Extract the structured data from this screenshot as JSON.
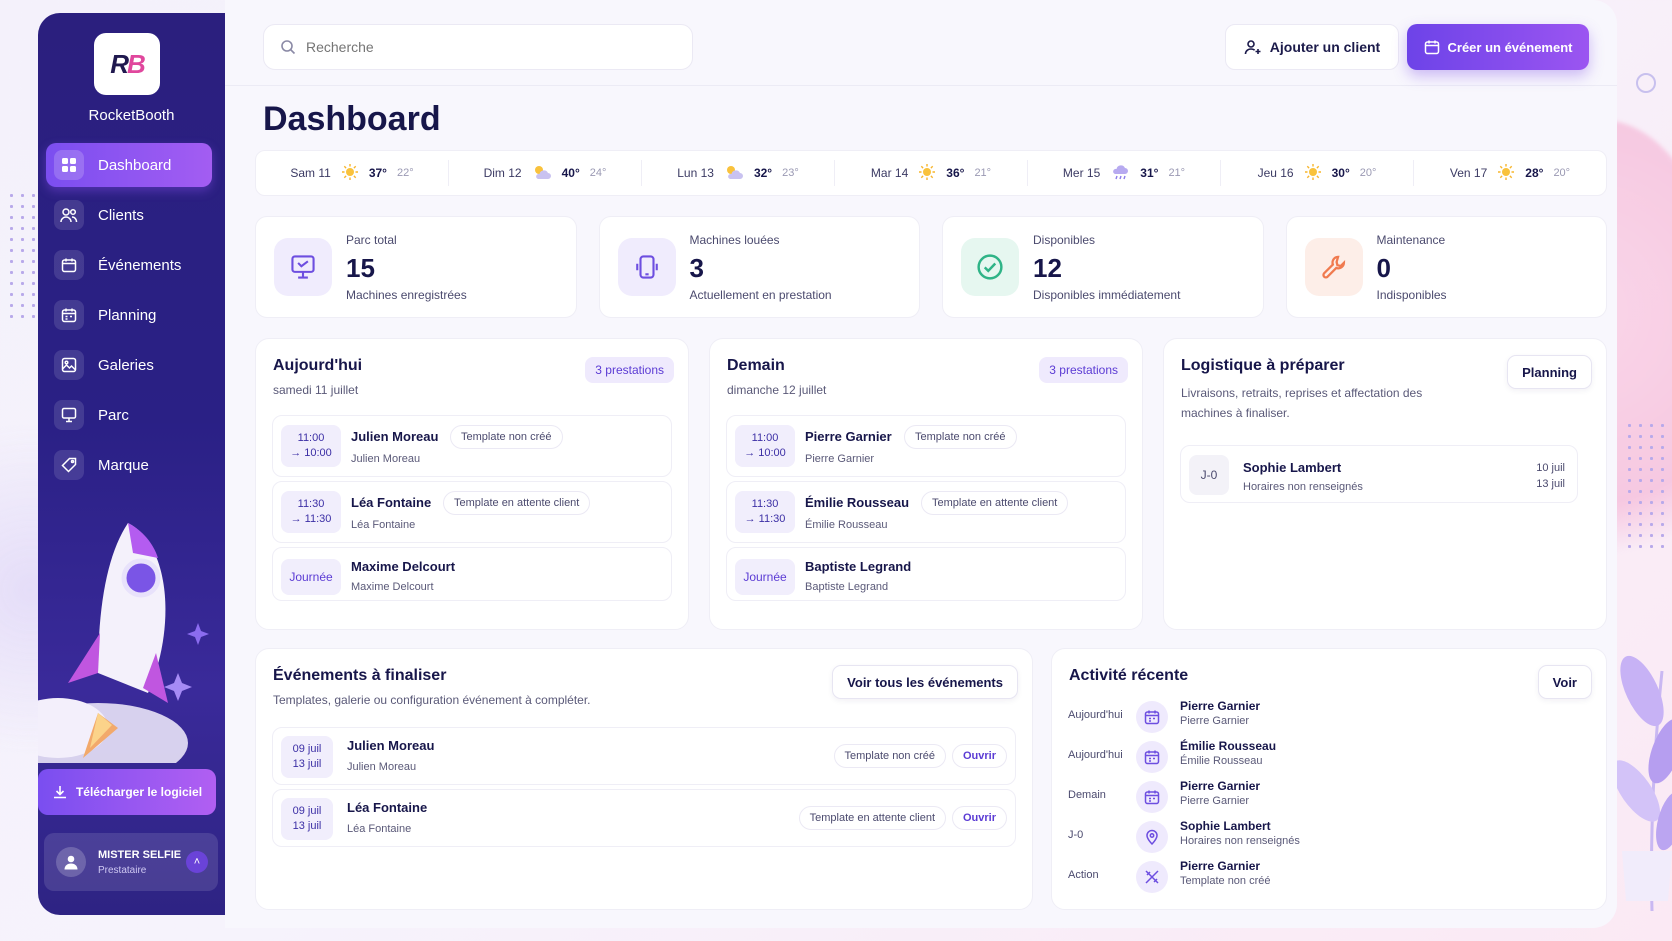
{
  "brand": {
    "name": "RocketBooth",
    "logo_text": "RB"
  },
  "sidebar": {
    "items": [
      {
        "label": "Dashboard",
        "icon": "grid-icon",
        "active": true
      },
      {
        "label": "Clients",
        "icon": "users-icon"
      },
      {
        "label": "Événements",
        "icon": "calendar-icon"
      },
      {
        "label": "Planning",
        "icon": "planning-icon"
      },
      {
        "label": "Galeries",
        "icon": "image-icon"
      },
      {
        "label": "Parc",
        "icon": "monitor-icon"
      },
      {
        "label": "Marque",
        "icon": "tag-icon"
      }
    ],
    "download_label": "Télécharger le logiciel",
    "user": {
      "name": "MISTER SELFIE",
      "role": "Prestataire"
    }
  },
  "header": {
    "search_placeholder": "Recherche",
    "add_client_label": "Ajouter un client",
    "create_event_label": "Créer un événement"
  },
  "page_title": "Dashboard",
  "weather": [
    {
      "day": "Sam 11",
      "icon": "sun",
      "max": "37°",
      "min": "22°"
    },
    {
      "day": "Dim 12",
      "icon": "partly-cloudy",
      "max": "40°",
      "min": "24°"
    },
    {
      "day": "Lun 13",
      "icon": "partly-cloudy",
      "max": "32°",
      "min": "23°"
    },
    {
      "day": "Mar 14",
      "icon": "sun",
      "max": "36°",
      "min": "21°"
    },
    {
      "day": "Mer 15",
      "icon": "rain",
      "max": "31°",
      "min": "21°"
    },
    {
      "day": "Jeu 16",
      "icon": "sun",
      "max": "30°",
      "min": "20°"
    },
    {
      "day": "Ven 17",
      "icon": "sun",
      "max": "28°",
      "min": "20°"
    }
  ],
  "stats": [
    {
      "label": "Parc total",
      "value": "15",
      "sub": "Machines enregistrées",
      "icon": "monitor-icon",
      "color": "#6d4ee0",
      "bg": "#f0ecfd"
    },
    {
      "label": "Machines louées",
      "value": "3",
      "sub": "Actuellement en prestation",
      "icon": "phone-icon",
      "color": "#6d4ee0",
      "bg": "#f0ecfd"
    },
    {
      "label": "Disponibles",
      "value": "12",
      "sub": "Disponibles immédiatement",
      "icon": "check-icon",
      "color": "#2fb487",
      "bg": "#e6f7f0"
    },
    {
      "label": "Maintenance",
      "value": "0",
      "sub": "Indisponibles",
      "icon": "wrench-icon",
      "color": "#f07a4f",
      "bg": "#fdeee8"
    }
  ],
  "today": {
    "title": "Aujourd'hui",
    "date": "samedi 11 juillet",
    "count": "3 prestations",
    "items": [
      {
        "t1": "11:00",
        "t2": "→ 10:00",
        "name": "Julien Moreau",
        "sub": "Julien Moreau",
        "tag": "Template non créé"
      },
      {
        "t1": "11:30",
        "t2": "→ 11:30",
        "name": "Léa Fontaine",
        "sub": "Léa Fontaine",
        "tag": "Template en attente client"
      },
      {
        "t1": "Journée",
        "t2": "",
        "name": "Maxime Delcourt",
        "sub": "Maxime Delcourt",
        "tag": ""
      }
    ]
  },
  "tomorrow": {
    "title": "Demain",
    "date": "dimanche 12 juillet",
    "count": "3 prestations",
    "items": [
      {
        "t1": "11:00",
        "t2": "→ 10:00",
        "name": "Pierre Garnier",
        "sub": "Pierre Garnier",
        "tag": "Template non créé"
      },
      {
        "t1": "11:30",
        "t2": "→ 11:30",
        "name": "Émilie Rousseau",
        "sub": "Émilie Rousseau",
        "tag": "Template en attente client"
      },
      {
        "t1": "Journée",
        "t2": "",
        "name": "Baptiste Legrand",
        "sub": "Baptiste Legrand",
        "tag": ""
      }
    ]
  },
  "logistics": {
    "title": "Logistique à préparer",
    "desc1": "Livraisons, retraits, reprises et affectation des",
    "desc2": "machines à finaliser.",
    "button": "Planning",
    "item": {
      "badge": "J-0",
      "name": "Sophie Lambert",
      "sub": "Horaires non renseignés",
      "d1": "10 juil",
      "d2": "13 juil"
    }
  },
  "finalize": {
    "title": "Événements à finaliser",
    "desc": "Templates, galerie ou configuration événement à compléter.",
    "button": "Voir tous les événements",
    "items": [
      {
        "d1": "09 juil",
        "d2": "13 juil",
        "name": "Julien Moreau",
        "sub": "Julien Moreau",
        "tag": "Template non créé",
        "action": "Ouvrir"
      },
      {
        "d1": "09 juil",
        "d2": "13 juil",
        "name": "Léa Fontaine",
        "sub": "Léa Fontaine",
        "tag": "Template en attente client",
        "action": "Ouvrir"
      }
    ]
  },
  "activity": {
    "title": "Activité récente",
    "button": "Voir",
    "items": [
      {
        "when": "Aujourd'hui",
        "icon": "calendar-icon",
        "name": "Pierre Garnier",
        "sub": "Pierre Garnier"
      },
      {
        "when": "Aujourd'hui",
        "icon": "calendar-icon",
        "name": "Émilie Rousseau",
        "sub": "Émilie Rousseau"
      },
      {
        "when": "Demain",
        "icon": "calendar-icon",
        "name": "Pierre Garnier",
        "sub": "Pierre Garnier"
      },
      {
        "when": "J-0",
        "icon": "pin-icon",
        "name": "Sophie Lambert",
        "sub": "Horaires non renseignés"
      },
      {
        "when": "Action",
        "icon": "tools-icon",
        "name": "Pierre Garnier",
        "sub": "Template non créé"
      }
    ]
  }
}
